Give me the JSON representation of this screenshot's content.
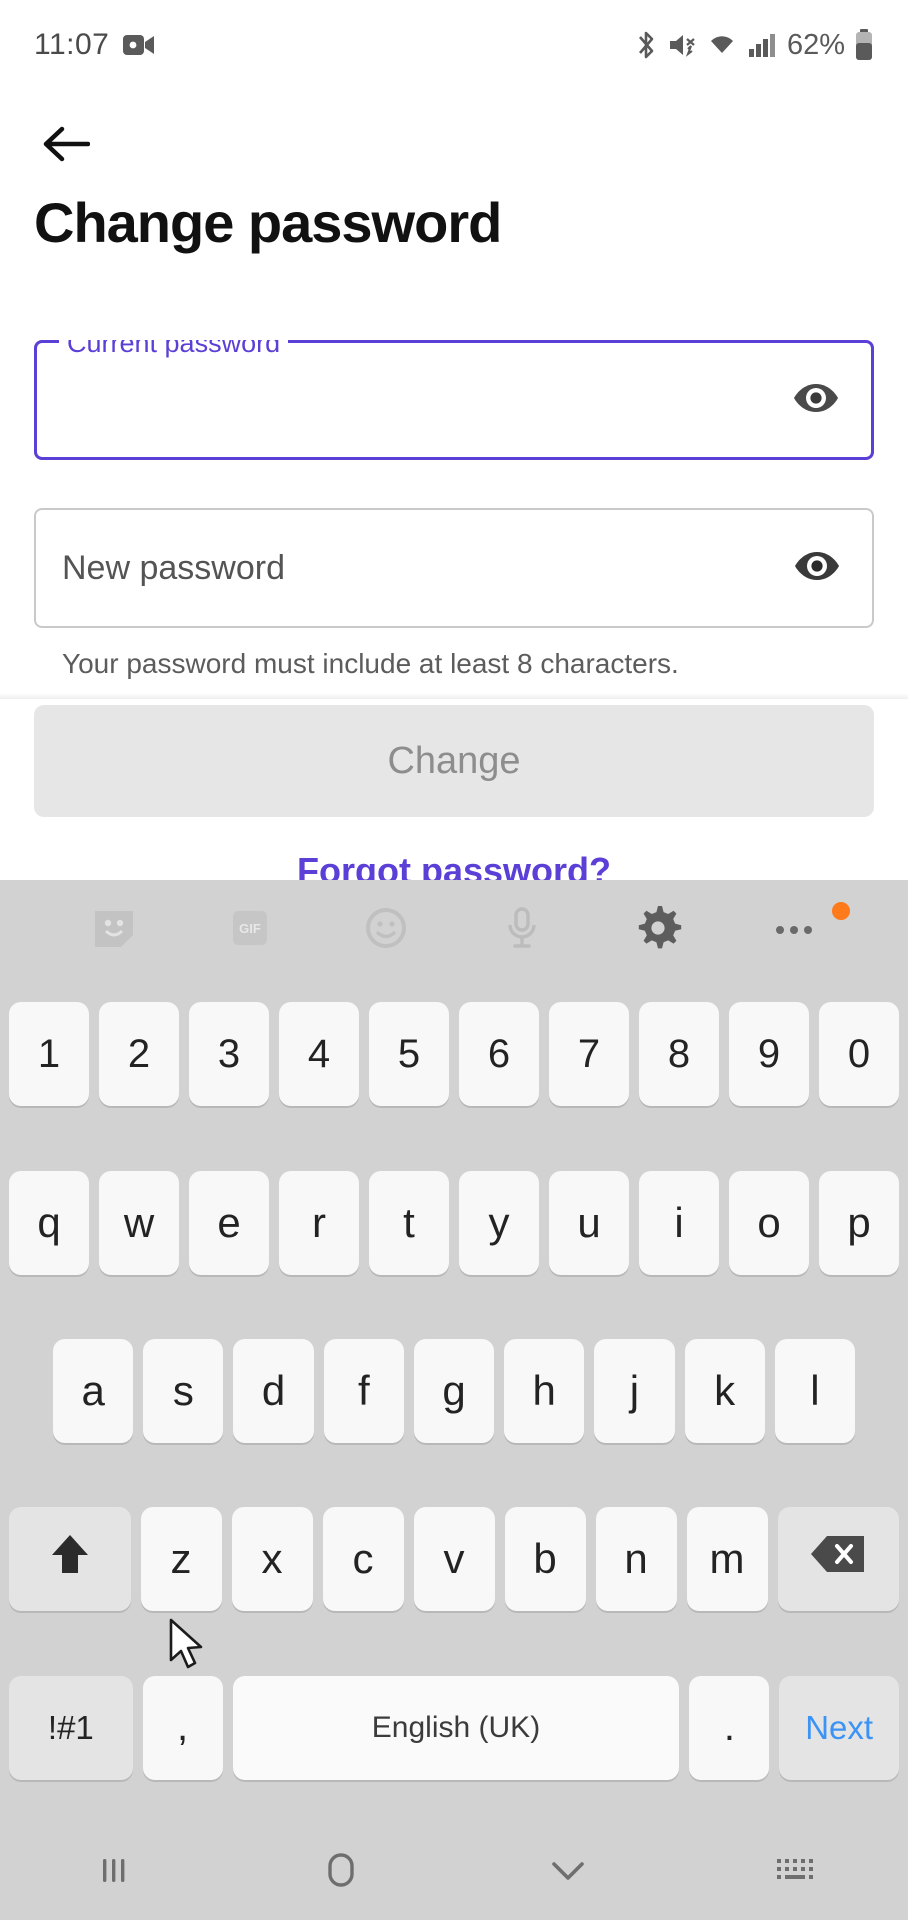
{
  "status_bar": {
    "time": "11:07",
    "battery_percent": "62%",
    "icons": [
      "video-camera-icon",
      "bluetooth-icon",
      "vibrate-mute-icon",
      "wifi-icon",
      "cellular-signal-icon",
      "battery-icon"
    ]
  },
  "app": {
    "back_icon": "back-arrow-icon",
    "title": "Change password"
  },
  "form": {
    "current_password": {
      "label": "Current password",
      "value": "",
      "placeholder": "",
      "focused": true,
      "toggle_icon": "eye-icon",
      "accent_color": "#5B3FD6"
    },
    "new_password": {
      "label": "New password",
      "value": "",
      "placeholder": "New password",
      "focused": false,
      "toggle_icon": "eye-icon",
      "helper_text": "Your password must include at least 8 characters."
    },
    "confirm_password": {
      "label": "",
      "value": "",
      "placeholder": "",
      "focused": false,
      "clipped": true
    },
    "submit_button": {
      "label": "Change",
      "enabled": false,
      "background": "#E6E6E6",
      "text_color": "#8D8D8D"
    },
    "forgot_link": {
      "label": "Forgot password?",
      "color": "#5B3FD6"
    }
  },
  "keyboard": {
    "background": "#D2D2D2",
    "toolbar": [
      {
        "name": "sticker-icon",
        "label": ""
      },
      {
        "name": "gif-icon",
        "label": "GIF"
      },
      {
        "name": "emoji-icon",
        "label": ""
      },
      {
        "name": "microphone-icon",
        "label": ""
      },
      {
        "name": "settings-gear-icon",
        "label": ""
      },
      {
        "name": "more-options-icon",
        "label": "",
        "badge": true
      }
    ],
    "rows": {
      "numbers": [
        "1",
        "2",
        "3",
        "4",
        "5",
        "6",
        "7",
        "8",
        "9",
        "0"
      ],
      "top": [
        "q",
        "w",
        "e",
        "r",
        "t",
        "y",
        "u",
        "i",
        "o",
        "p"
      ],
      "home": [
        "a",
        "s",
        "d",
        "f",
        "g",
        "h",
        "j",
        "k",
        "l"
      ],
      "bottom": [
        "z",
        "x",
        "c",
        "v",
        "b",
        "n",
        "m"
      ]
    },
    "shift_key": {
      "icon": "shift-arrow-icon"
    },
    "backspace_key": {
      "icon": "backspace-icon"
    },
    "symbols_key": {
      "label": "!#1"
    },
    "comma_key": {
      "label": ","
    },
    "space_key": {
      "label": "English (UK)"
    },
    "period_key": {
      "label": "."
    },
    "next_key": {
      "label": "Next",
      "color": "#3B93F5"
    }
  },
  "nav_bar": {
    "items": [
      {
        "name": "recents-icon"
      },
      {
        "name": "home-icon"
      },
      {
        "name": "hide-keyboard-icon"
      },
      {
        "name": "keyboard-switch-icon"
      }
    ]
  }
}
